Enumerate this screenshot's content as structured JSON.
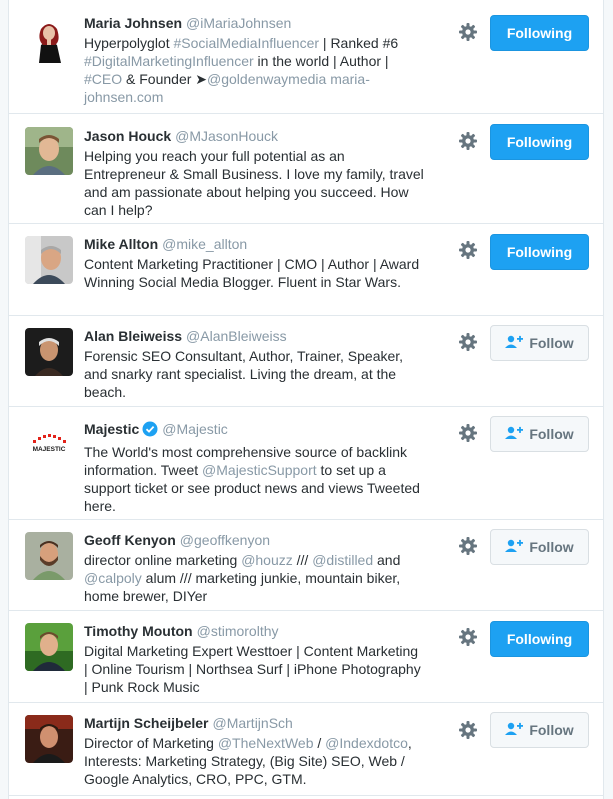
{
  "users": [
    {
      "name": "Maria Johnsen",
      "handle": "@iMariaJohnsen",
      "verified": false,
      "bio": [
        {
          "t": "Hyperpolyglot ",
          "link": false
        },
        {
          "t": "#SocialMediaInfluencer",
          "link": true
        },
        {
          "t": " | Ranked #6 ",
          "link": false
        },
        {
          "t": "#DigitalMarketingInfluencer",
          "link": true
        },
        {
          "t": " in the world | Author | ",
          "link": false
        },
        {
          "t": "#CEO",
          "link": true
        },
        {
          "t": " & Founder ➤",
          "link": false
        },
        {
          "t": "@goldenwaymedia",
          "link": true
        },
        {
          "t": " ",
          "link": false
        },
        {
          "t": "maria-johnsen.com",
          "link": true
        }
      ],
      "button": "Following",
      "following": true
    },
    {
      "name": "Jason Houck",
      "handle": "@MJasonHouck",
      "verified": false,
      "bio": [
        {
          "t": "Helping you reach your full potential as an Entrepreneur & Small Business. I love my family, travel and am passionate about helping you succeed. How can I help?",
          "link": false
        }
      ],
      "button": "Following",
      "following": true
    },
    {
      "name": "Mike Allton",
      "handle": "@mike_allton",
      "verified": false,
      "bio": [
        {
          "t": "Content Marketing Practitioner | CMO | Author | Award Winning Social Media Blogger. Fluent in Star Wars.",
          "link": false
        }
      ],
      "button": "Following",
      "following": true
    },
    {
      "name": "Alan Bleiweiss",
      "handle": "@AlanBleiweiss",
      "verified": false,
      "bio": [
        {
          "t": "Forensic SEO Consultant, Author, Trainer, Speaker, and snarky rant specialist. Living the dream, at the beach.",
          "link": false
        }
      ],
      "button": "Follow",
      "following": false
    },
    {
      "name": "Majestic",
      "handle": "@Majestic",
      "verified": true,
      "logo_text": "MAJESTIC",
      "bio": [
        {
          "t": "The World's most comprehensive source of backlink information. Tweet ",
          "link": false
        },
        {
          "t": "@MajesticSupport",
          "link": true
        },
        {
          "t": " to set up a support ticket or see product news and views Tweeted here.",
          "link": false
        }
      ],
      "button": "Follow",
      "following": false
    },
    {
      "name": "Geoff Kenyon",
      "handle": "@geoffkenyon",
      "verified": false,
      "bio": [
        {
          "t": "director online marketing ",
          "link": false
        },
        {
          "t": "@houzz",
          "link": true
        },
        {
          "t": " /// ",
          "link": false
        },
        {
          "t": "@distilled",
          "link": true
        },
        {
          "t": " and ",
          "link": false
        },
        {
          "t": "@calpoly",
          "link": true
        },
        {
          "t": " alum /// marketing junkie, mountain biker, home brewer, DIYer",
          "link": false
        }
      ],
      "button": "Follow",
      "following": false
    },
    {
      "name": "Timothy Mouton",
      "handle": "@stimorolthy",
      "verified": false,
      "bio": [
        {
          "t": "Digital Marketing Expert Westtoer | Content Marketing | Online Tourism | Northsea Surf | iPhone Photography | Punk Rock Music",
          "link": false
        }
      ],
      "button": "Following",
      "following": true
    },
    {
      "name": "Martijn Scheijbeler",
      "handle": "@MartijnSch",
      "verified": false,
      "bio": [
        {
          "t": "Director of Marketing ",
          "link": false
        },
        {
          "t": "@TheNextWeb",
          "link": true
        },
        {
          "t": " / ",
          "link": false
        },
        {
          "t": "@Indexdotco",
          "link": true
        },
        {
          "t": ", Interests: Marketing Strategy, (Big Site) SEO, Web / Google Analytics, CRO, PPC, GTM.",
          "link": false
        }
      ],
      "button": "Follow",
      "following": false
    }
  ],
  "colors": {
    "accent": "#1da1f2",
    "link": "#8899a6",
    "text": "#292f33",
    "muted": "#66757f",
    "majestic_red": "#e2231a"
  },
  "icons": {
    "gear": "gear-icon",
    "follow": "add-user-icon",
    "verified": "verified-badge-icon"
  }
}
